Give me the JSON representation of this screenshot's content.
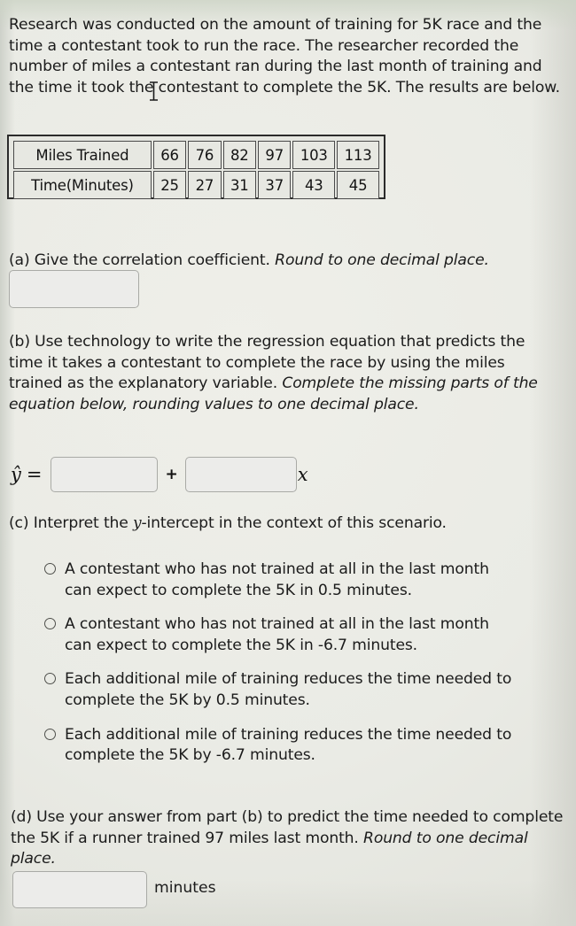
{
  "problem": {
    "intro": "Research was conducted on the amount of training for 5K race and the time a contestant took to run the race. The researcher recorded the number of miles a contestant ran during the last month of training and the time it took the contestant to complete the 5K. The results are below."
  },
  "table": {
    "rows": [
      {
        "label": "Miles Trained",
        "values": [
          "66",
          "76",
          "82",
          "97",
          "103",
          "113"
        ]
      },
      {
        "label": "Time(Minutes)",
        "values": [
          "25",
          "27",
          "31",
          "37",
          "43",
          "45"
        ]
      }
    ]
  },
  "chart_data": {
    "type": "table",
    "title": "Miles Trained vs Time(Minutes)",
    "xlabel": "Miles Trained",
    "ylabel": "Time(Minutes)",
    "x": [
      66,
      76,
      82,
      97,
      103,
      113
    ],
    "series": [
      {
        "name": "Time(Minutes)",
        "values": [
          25,
          27,
          31,
          37,
          43,
          45
        ]
      }
    ],
    "categories": [
      "66",
      "76",
      "82",
      "97",
      "103",
      "113"
    ]
  },
  "parts": {
    "a": {
      "prompt_plain": "(a) Give the correlation coefficient. ",
      "prompt_italic": "Round to one decimal place.",
      "answer_value": "",
      "answer_placeholder": ""
    },
    "b": {
      "prompt_plain": "(b) Use technology to write the regression equation that predicts the time it takes a contestant to complete the race by using the miles trained as the explanatory variable. ",
      "prompt_italic": "Complete the missing parts of the equation below, rounding values to one decimal place.",
      "equation": {
        "lhs": "ŷ",
        "equals": "=",
        "plus": "+",
        "x_label": "x",
        "intercept_value": "",
        "slope_value": ""
      }
    },
    "c": {
      "prompt_pre": "(c) Interpret the ",
      "prompt_var": "y",
      "prompt_post": "-intercept in the context of this scenario.",
      "options": [
        {
          "line1": "A contestant who has not trained at all in the last month",
          "line2": "can expect to complete the 5K in 0.5 minutes.",
          "selected": false
        },
        {
          "line1": "A contestant who has not trained at all in the last month",
          "line2": "can expect to complete the 5K in -6.7 minutes.",
          "selected": false
        },
        {
          "line1": "Each additional mile of training reduces the time needed to",
          "line2": "complete the 5K by 0.5 minutes.",
          "selected": false
        },
        {
          "line1": "Each additional mile of training reduces the time needed to",
          "line2": "complete the 5K by -6.7 minutes.",
          "selected": false
        }
      ]
    },
    "d": {
      "prompt_plain": "(d) Use your answer from part (b) to predict the time needed to complete the 5K if a runner trained 97 miles last month. ",
      "prompt_italic": "Round to one decimal place.",
      "answer_value": "",
      "unit_label": "minutes"
    }
  },
  "colors": {
    "page_background": "#e9eae5",
    "text": "#1b1b1b",
    "table_border": "#2b2b2b",
    "input_border": "#a9aaa6"
  }
}
